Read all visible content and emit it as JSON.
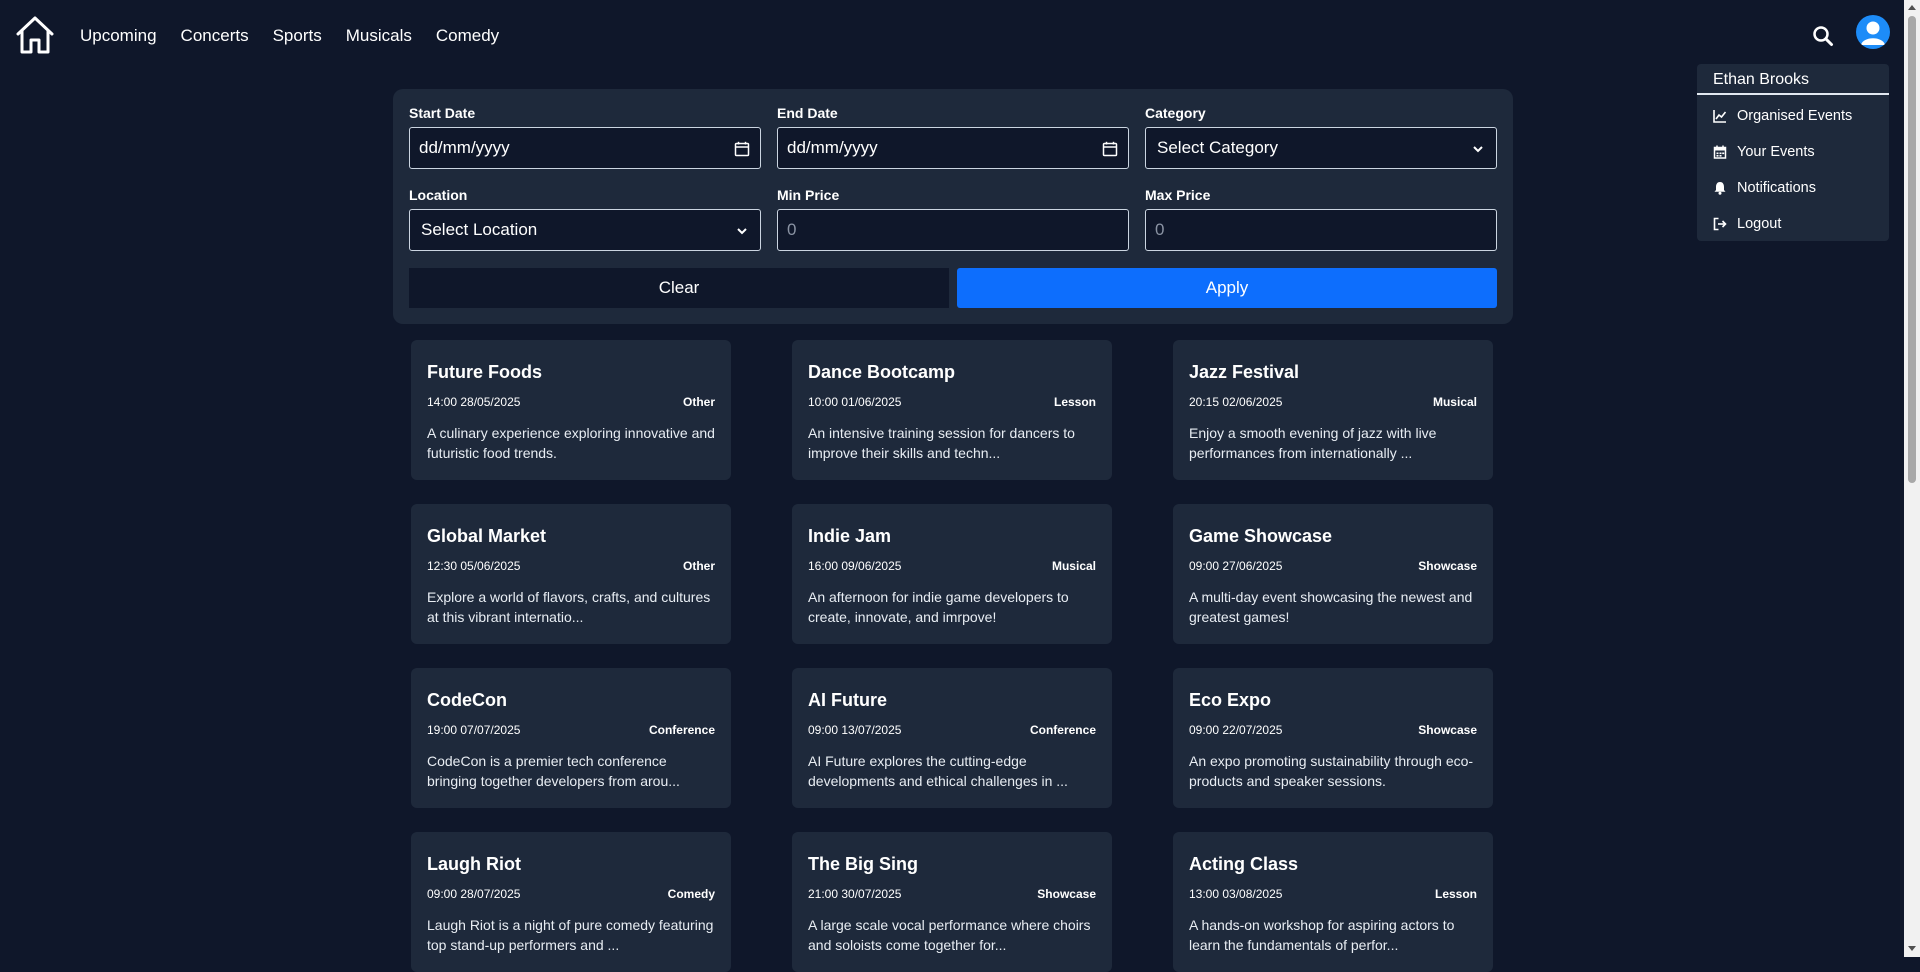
{
  "nav": {
    "home_icon": "home-icon",
    "links": [
      "Upcoming",
      "Concerts",
      "Sports",
      "Musicals",
      "Comedy"
    ],
    "search_icon": "search-icon",
    "avatar_icon": "user-avatar-icon"
  },
  "user_menu": {
    "name": "Ethan Brooks",
    "items": [
      {
        "label": "Organised Events",
        "icon": "chart-line-icon"
      },
      {
        "label": "Your Events",
        "icon": "calendar-icon"
      },
      {
        "label": "Notifications",
        "icon": "bell-icon"
      },
      {
        "label": "Logout",
        "icon": "logout-icon"
      }
    ]
  },
  "filters": {
    "start_date": {
      "label": "Start Date",
      "value": "dd/mm/yyyy"
    },
    "end_date": {
      "label": "End Date",
      "value": "dd/mm/yyyy"
    },
    "category": {
      "label": "Category",
      "value": "Select Category"
    },
    "location": {
      "label": "Location",
      "value": "Select Location"
    },
    "min_price": {
      "label": "Min Price",
      "placeholder": "0"
    },
    "max_price": {
      "label": "Max Price",
      "placeholder": "0"
    },
    "clear_label": "Clear",
    "apply_label": "Apply"
  },
  "events": [
    {
      "title": "Future Foods",
      "datetime": "14:00 28/05/2025",
      "category": "Other",
      "description": "A culinary experience exploring innovative and futuristic food trends."
    },
    {
      "title": "Dance Bootcamp",
      "datetime": "10:00 01/06/2025",
      "category": "Lesson",
      "description": "An intensive training session for dancers to improve their skills and techn..."
    },
    {
      "title": "Jazz Festival",
      "datetime": "20:15 02/06/2025",
      "category": "Musical",
      "description": "Enjoy a smooth evening of jazz with live performances from internationally ..."
    },
    {
      "title": "Global Market",
      "datetime": "12:30 05/06/2025",
      "category": "Other",
      "description": "Explore a world of flavors, crafts, and cultures at this vibrant internatio..."
    },
    {
      "title": "Indie Jam",
      "datetime": "16:00 09/06/2025",
      "category": "Musical",
      "description": "An afternoon for indie game developers to create, innovate, and imrpove!"
    },
    {
      "title": "Game Showcase",
      "datetime": "09:00 27/06/2025",
      "category": "Showcase",
      "description": "A multi-day event showcasing the newest and greatest games!"
    },
    {
      "title": "CodeCon",
      "datetime": "19:00 07/07/2025",
      "category": "Conference",
      "description": "CodeCon is a premier tech conference bringing together developers from arou..."
    },
    {
      "title": "AI Future",
      "datetime": "09:00 13/07/2025",
      "category": "Conference",
      "description": "AI Future explores the cutting-edge developments and ethical challenges in ..."
    },
    {
      "title": "Eco Expo",
      "datetime": "09:00 22/07/2025",
      "category": "Showcase",
      "description": "An expo promoting sustainability through eco-products and speaker sessions."
    },
    {
      "title": "Laugh Riot",
      "datetime": "09:00 28/07/2025",
      "category": "Comedy",
      "description": "Laugh Riot is a night of pure comedy featuring top stand-up performers and ..."
    },
    {
      "title": "The Big Sing",
      "datetime": "21:00 30/07/2025",
      "category": "Showcase",
      "description": "A large scale vocal performance where choirs and soloists come together for..."
    },
    {
      "title": "Acting Class",
      "datetime": "13:00 03/08/2025",
      "category": "Lesson",
      "description": "A hands-on workshop for aspiring actors to learn the fundamentals of perfor..."
    }
  ],
  "colors": {
    "background": "#0f172a",
    "panel": "#1e293b",
    "accent": "#0d6efd",
    "avatar": "#1d8cf8"
  }
}
